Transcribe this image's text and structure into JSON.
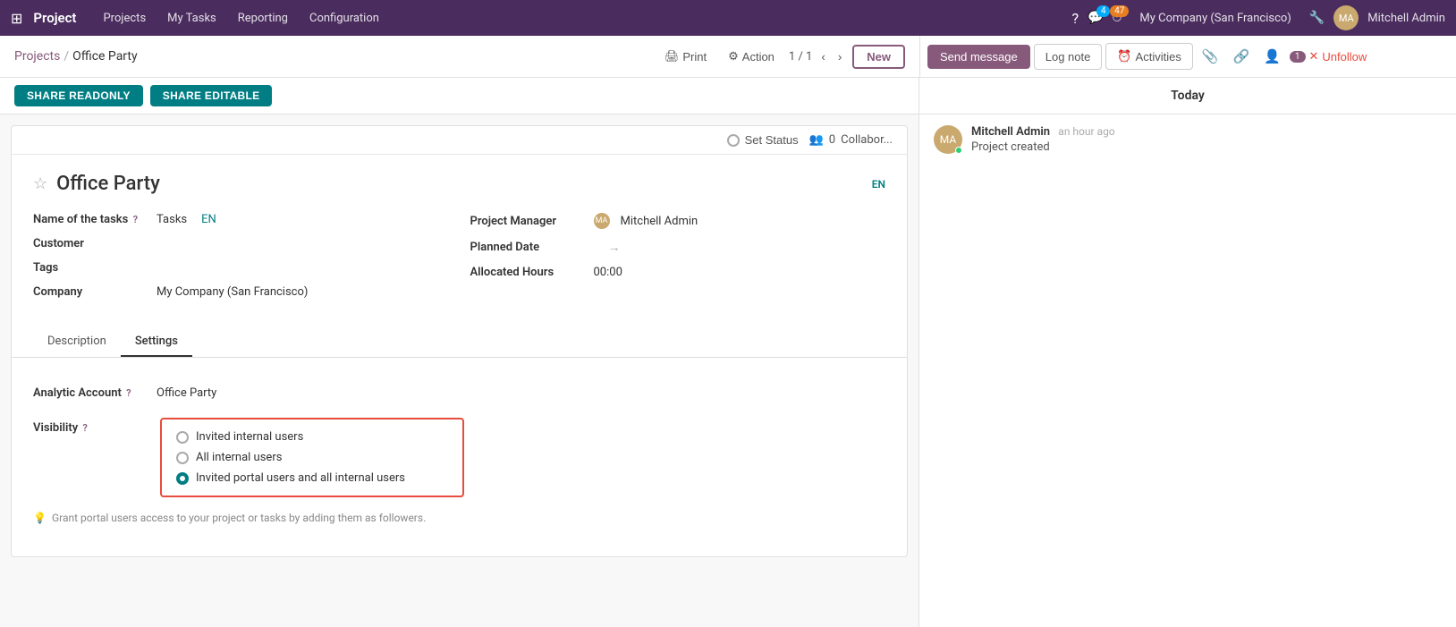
{
  "topnav": {
    "app_name": "Project",
    "nav_items": [
      "Projects",
      "My Tasks",
      "Reporting",
      "Configuration"
    ],
    "company": "My Company (San Francisco)",
    "user": "Mitchell Admin",
    "chat_badge": "4",
    "activity_badge": "47"
  },
  "breadcrumb": {
    "parent": "Projects",
    "current": "Office Party"
  },
  "toolbar": {
    "print_label": "Print",
    "action_label": "Action",
    "pager": "1 / 1",
    "new_label": "New"
  },
  "right_toolbar": {
    "send_message": "Send message",
    "log_note": "Log note",
    "activities": "Activities",
    "follower_count": "1",
    "unfollow": "Unfollow"
  },
  "share_bar": {
    "share_readonly": "SHARE READONLY",
    "share_editable": "SHARE EDITABLE"
  },
  "form": {
    "status_btn": "Set Status",
    "collaborators_count": "0",
    "collaborators_label": "Collabor...",
    "star": "☆",
    "title": "Office Party",
    "lang": "EN",
    "fields": {
      "name_of_tasks_label": "Name of the tasks",
      "name_of_tasks_value": "Tasks",
      "name_of_tasks_lang": "EN",
      "customer_label": "Customer",
      "tags_label": "Tags",
      "company_label": "Company",
      "company_value": "My Company (San Francisco)",
      "project_manager_label": "Project Manager",
      "project_manager_value": "Mitchell Admin",
      "planned_date_label": "Planned Date",
      "allocated_hours_label": "Allocated Hours",
      "allocated_hours_value": "00:00"
    },
    "tabs": {
      "description": "Description",
      "settings": "Settings"
    },
    "settings": {
      "analytic_account_label": "Analytic Account",
      "analytic_account_value": "Office Party",
      "visibility_label": "Visibility",
      "visibility_options": [
        {
          "label": "Invited internal users",
          "selected": false
        },
        {
          "label": "All internal users",
          "selected": false
        },
        {
          "label": "Invited portal users and all internal users",
          "selected": true
        }
      ],
      "hint_text": "Grant portal users access to your project or tasks by adding them as followers."
    }
  },
  "right_panel": {
    "today_label": "Today",
    "message": {
      "author": "Mitchell Admin",
      "time": "an hour ago",
      "text": "Project created"
    }
  }
}
